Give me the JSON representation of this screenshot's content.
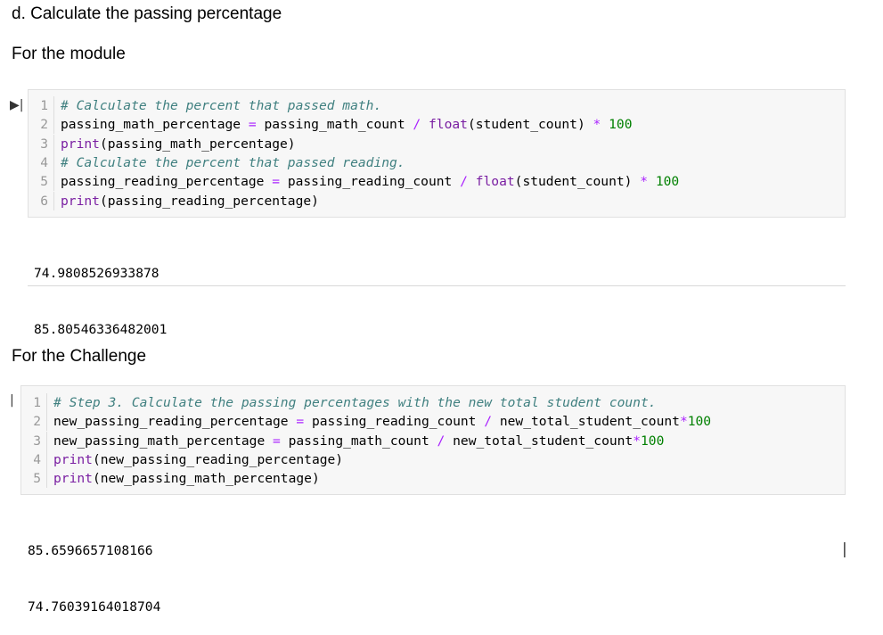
{
  "headings": {
    "section_d": "d. Calculate the passing percentage",
    "module": "For the module",
    "challenge": "For the Challenge"
  },
  "cell1": {
    "lines": [
      {
        "n": "1",
        "parts": [
          {
            "t": "# Calculate the percent that passed math.",
            "c": "cm"
          }
        ]
      },
      {
        "n": "2",
        "parts": [
          {
            "t": "passing_math_percentage ",
            "c": ""
          },
          {
            "t": "=",
            "c": "op"
          },
          {
            "t": " passing_math_count ",
            "c": ""
          },
          {
            "t": "/",
            "c": "op"
          },
          {
            "t": " ",
            "c": ""
          },
          {
            "t": "float",
            "c": "kw"
          },
          {
            "t": "(student_count) ",
            "c": ""
          },
          {
            "t": "*",
            "c": "op"
          },
          {
            "t": " ",
            "c": ""
          },
          {
            "t": "100",
            "c": "num"
          }
        ]
      },
      {
        "n": "3",
        "parts": [
          {
            "t": "print",
            "c": "kw"
          },
          {
            "t": "(passing_math_percentage)",
            "c": ""
          }
        ]
      },
      {
        "n": "4",
        "parts": [
          {
            "t": "# Calculate the percent that passed reading.",
            "c": "cm"
          }
        ]
      },
      {
        "n": "5",
        "parts": [
          {
            "t": "passing_reading_percentage ",
            "c": ""
          },
          {
            "t": "=",
            "c": "op"
          },
          {
            "t": " passing_reading_count ",
            "c": ""
          },
          {
            "t": "/",
            "c": "op"
          },
          {
            "t": " ",
            "c": ""
          },
          {
            "t": "float",
            "c": "kw"
          },
          {
            "t": "(student_count) ",
            "c": ""
          },
          {
            "t": "*",
            "c": "op"
          },
          {
            "t": " ",
            "c": ""
          },
          {
            "t": "100",
            "c": "num"
          }
        ]
      },
      {
        "n": "6",
        "parts": [
          {
            "t": "print",
            "c": "kw"
          },
          {
            "t": "(passing_reading_percentage)",
            "c": ""
          }
        ]
      }
    ],
    "output": [
      "74.9808526933878",
      "85.80546336482001"
    ]
  },
  "cell2": {
    "lines": [
      {
        "n": "1",
        "parts": [
          {
            "t": "# Step 3. Calculate the passing percentages with the new total student count.",
            "c": "cm"
          }
        ]
      },
      {
        "n": "2",
        "parts": [
          {
            "t": "new_passing_reading_percentage ",
            "c": ""
          },
          {
            "t": "=",
            "c": "op"
          },
          {
            "t": " passing_reading_count ",
            "c": ""
          },
          {
            "t": "/",
            "c": "op"
          },
          {
            "t": " new_total_student_count",
            "c": ""
          },
          {
            "t": "*",
            "c": "op"
          },
          {
            "t": "100",
            "c": "num"
          }
        ]
      },
      {
        "n": "3",
        "parts": [
          {
            "t": "new_passing_math_percentage ",
            "c": ""
          },
          {
            "t": "=",
            "c": "op"
          },
          {
            "t": " passing_math_count ",
            "c": ""
          },
          {
            "t": "/",
            "c": "op"
          },
          {
            "t": " new_total_student_count",
            "c": ""
          },
          {
            "t": "*",
            "c": "op"
          },
          {
            "t": "100",
            "c": "num"
          }
        ]
      },
      {
        "n": "4",
        "parts": [
          {
            "t": "print",
            "c": "kw"
          },
          {
            "t": "(new_passing_reading_percentage)",
            "c": ""
          }
        ]
      },
      {
        "n": "5",
        "parts": [
          {
            "t": "print",
            "c": "kw"
          },
          {
            "t": "(new_passing_math_percentage)",
            "c": ""
          }
        ]
      }
    ],
    "output": [
      "85.6596657108166",
      "74.76039164018704"
    ]
  },
  "icons": {
    "run": "▶|",
    "cursor": "|",
    "text_cursor": "|"
  },
  "colors": {
    "comment": "#408080",
    "keyword": "#7a1fa2",
    "operator": "#aa22ff",
    "number": "#008000"
  }
}
